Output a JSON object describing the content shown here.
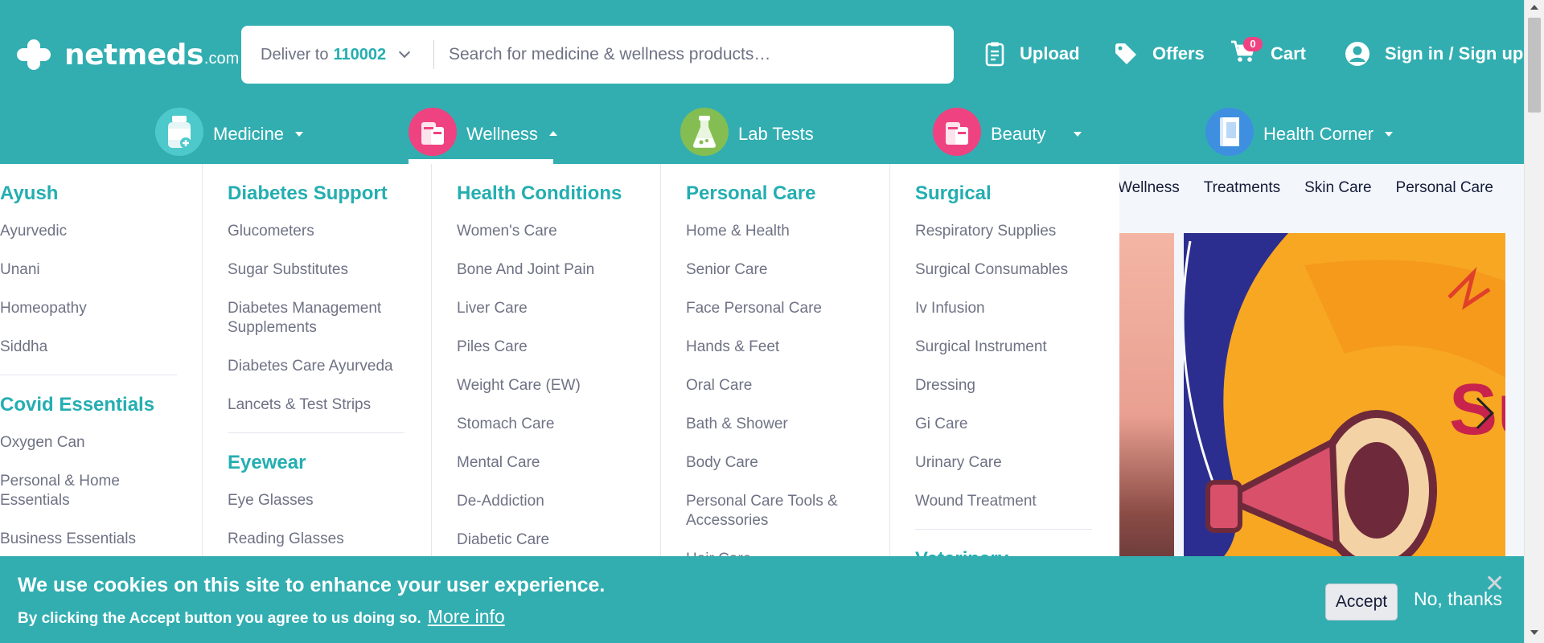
{
  "header": {
    "logo_text": "netmeds",
    "logo_suffix": ".com",
    "deliver_label": "Deliver to",
    "pincode": "110002",
    "search_placeholder": "Search for medicine & wellness products…",
    "upload": "Upload",
    "offers": "Offers",
    "cart": "Cart",
    "cart_count": "0",
    "signin": "Sign in / Sign up"
  },
  "categories": [
    {
      "label": "Medicine",
      "icon": "medicine-bottle-icon",
      "color": "#4dc9cb"
    },
    {
      "label": "Wellness",
      "icon": "wellness-products-icon",
      "color": "#ef4281"
    },
    {
      "label": "Lab Tests",
      "icon": "lab-flask-icon",
      "color": "#84be52"
    },
    {
      "label": "Beauty",
      "icon": "beauty-products-icon",
      "color": "#ef4281"
    },
    {
      "label": "Health Corner",
      "icon": "health-corner-book-icon",
      "color": "#3f8fe0"
    }
  ],
  "subnav": [
    "Wellness",
    "Treatments",
    "Skin Care",
    "Personal Care"
  ],
  "mega_menu": {
    "col1": {
      "groups": [
        {
          "title": "Ayush",
          "items": [
            "Ayurvedic",
            "Unani",
            "Homeopathy",
            "Siddha"
          ]
        },
        {
          "title": "Covid Essentials",
          "items": [
            "Oxygen Can",
            "Personal & Home Essentials",
            "Business Essentials"
          ]
        }
      ]
    },
    "col2": {
      "groups": [
        {
          "title": "Diabetes Support",
          "items": [
            "Glucometers",
            "Sugar Substitutes",
            "Diabetes Management Supplements",
            "Diabetes Care Ayurveda",
            "Lancets & Test Strips"
          ]
        },
        {
          "title": "Eyewear",
          "items": [
            "Eye Glasses",
            "Reading Glasses"
          ]
        }
      ]
    },
    "col3": {
      "groups": [
        {
          "title": "Health Conditions",
          "items": [
            "Women's Care",
            "Bone And Joint Pain",
            "Liver Care",
            "Piles Care",
            "Weight Care (EW)",
            "Stomach Care",
            "Mental Care",
            "De-Addiction",
            "Diabetic Care"
          ]
        }
      ]
    },
    "col4": {
      "groups": [
        {
          "title": "Personal Care",
          "items": [
            "Home & Health",
            "Senior Care",
            "Face Personal Care",
            "Hands & Feet",
            "Oral Care",
            "Bath & Shower",
            "Body Care",
            "Personal Care Tools & Accessories",
            "Hair Care"
          ]
        }
      ]
    },
    "col5": {
      "groups": [
        {
          "title": "Surgical",
          "items": [
            "Respiratory Supplies",
            "Surgical Consumables",
            "Iv Infusion",
            "Surgical Instrument",
            "Dressing",
            "Gi Care",
            "Urinary Care",
            "Wound Treatment"
          ]
        },
        {
          "title": "Veterinary",
          "items": []
        }
      ]
    }
  },
  "cookie_banner": {
    "title": "We use cookies on this site to enhance your user experience.",
    "text": "By clicking the Accept button you agree to us doing so.",
    "more_info": "More info",
    "accept": "Accept",
    "no_thanks": "No, thanks",
    "close": "✕"
  },
  "colors": {
    "brand": "#32aeb1",
    "heading": "#24aeb1",
    "text_muted": "#6f7284",
    "badge": "#ef4281"
  }
}
